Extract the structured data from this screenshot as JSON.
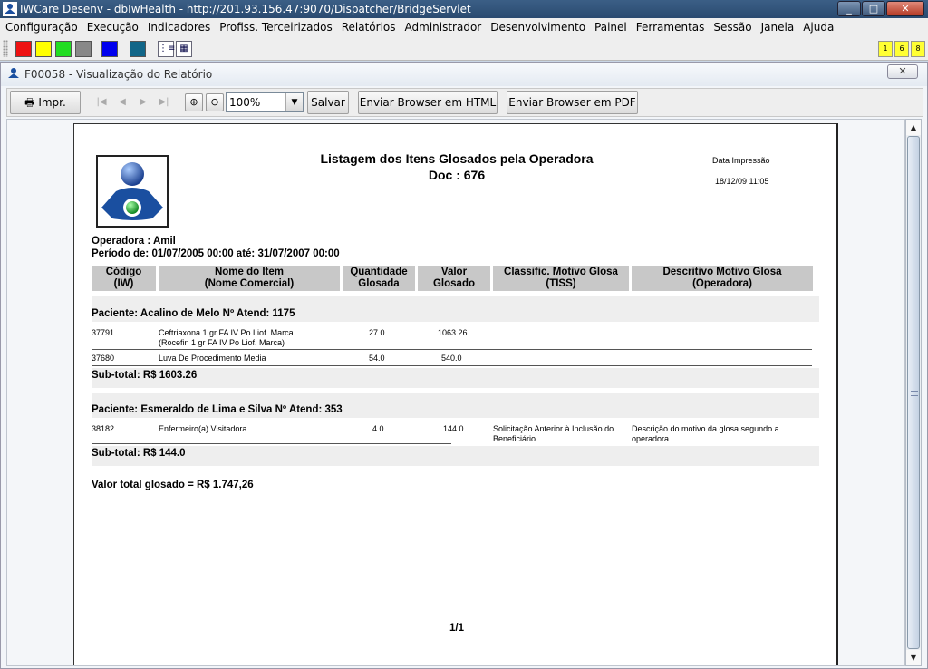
{
  "window": {
    "title": "IWCare Desenv - dbIwHealth - http://201.93.156.47:9070/Dispatcher/BridgeServlet",
    "controls": [
      "_",
      "□",
      "✕"
    ]
  },
  "menu": [
    "Configuração",
    "Execução",
    "Indicadores",
    "Profiss. Terceirizados",
    "Relatórios",
    "Administrador",
    "Desenvolvimento",
    "Painel",
    "Ferramentas",
    "Sessão",
    "Janela",
    "Ajuda"
  ],
  "toolbar": {
    "colors": [
      "#ee1111",
      "#ffff00",
      "#22dd22",
      "#888888",
      "#0000ee",
      "#116688"
    ],
    "badges": [
      "1",
      "6",
      "8"
    ]
  },
  "frame": {
    "title": "F00058 - Visualização do Relatório",
    "close": "✕"
  },
  "report_toolbar": {
    "print_label": "Impr.",
    "zoom_value": "100%",
    "save_label": "Salvar",
    "html_label": "Enviar Browser em HTML",
    "pdf_label": "Enviar Browser em PDF"
  },
  "report": {
    "title": "Listagem dos Itens Glosados pela Operadora",
    "doc": "Doc : 676",
    "print_date_label": "Data Impressão",
    "print_date": "18/12/09 11:05",
    "operadora": "Operadora : Amil",
    "periodo": "Período de: 01/07/2005 00:00  até: 31/07/2007 00:00",
    "headers": [
      [
        "Código",
        "(IW)"
      ],
      [
        "Nome do Item",
        "(Nome Comercial)"
      ],
      [
        "Quantidade",
        "Glosada"
      ],
      [
        "Valor",
        "Glosado"
      ],
      [
        "Classific. Motivo Glosa",
        "(TISS)"
      ],
      [
        "Descritivo Motivo Glosa",
        "(Operadora)"
      ]
    ],
    "groups": [
      {
        "paciente": "Paciente: Acalino de Melo   Nº Atend: 1175",
        "rows": [
          {
            "codigo": "37791",
            "nome": [
              "Ceftriaxona   1 gr  FA  IV Po Liof.   Marca",
              "(Rocefin   1 gr  FA  IV Po Liof.   Marca)"
            ],
            "qtd": "27.0",
            "valor": "1063.26",
            "classif": [],
            "descr": []
          },
          {
            "codigo": "37680",
            "nome": [
              "Luva De Procedimento Media"
            ],
            "qtd": "54.0",
            "valor": "540.0",
            "classif": [],
            "descr": []
          }
        ],
        "subtotal": "Sub-total:   R$ 1603.26"
      },
      {
        "paciente": "Paciente: Esmeraldo de Lima e Silva   Nº Atend: 353",
        "rows": [
          {
            "codigo": "38182",
            "nome": [
              "Enfermeiro(a) Visitadora"
            ],
            "qtd": "4.0",
            "valor": "144.0",
            "classif": [
              "Solicitação Anterior à Inclusão do",
              "Beneficiário"
            ],
            "descr": [
              "Descrição do motivo da glosa segundo a",
              "operadora"
            ]
          }
        ],
        "subtotal": "Sub-total:   R$ 144.0"
      }
    ],
    "total": "Valor total glosado = R$ 1.747,26",
    "page": "1/1"
  }
}
